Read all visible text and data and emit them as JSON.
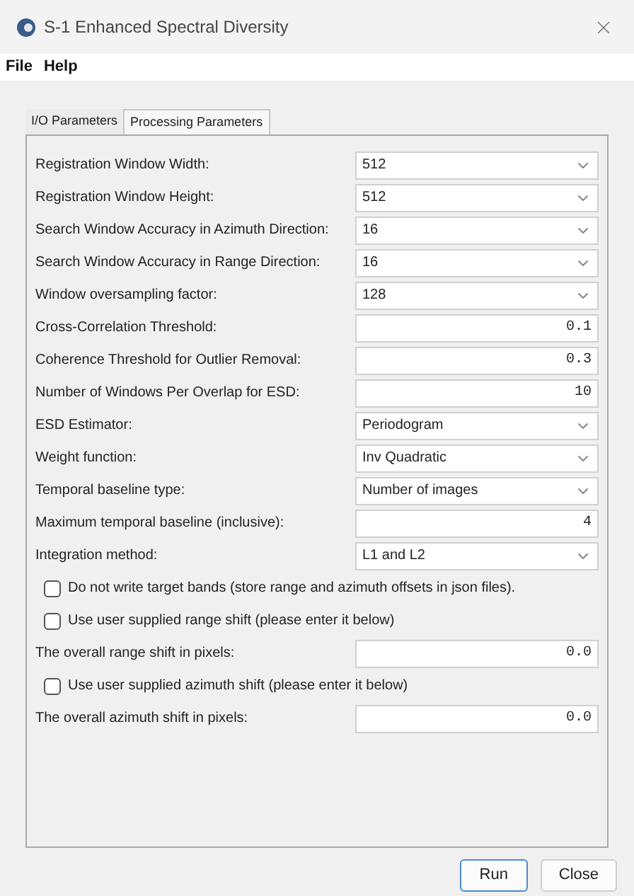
{
  "window": {
    "title": "S-1 Enhanced Spectral Diversity"
  },
  "menu": [
    "File",
    "Help"
  ],
  "tabs": [
    {
      "label": "I/O Parameters",
      "selected": false
    },
    {
      "label": "Processing Parameters",
      "selected": true
    }
  ],
  "rows": [
    {
      "kind": "combo",
      "label": "Registration Window Width:",
      "value": "512"
    },
    {
      "kind": "combo",
      "label": "Registration Window Height:",
      "value": "512"
    },
    {
      "kind": "combo",
      "label": "Search Window Accuracy in Azimuth Direction:",
      "value": "16"
    },
    {
      "kind": "combo",
      "label": "Search Window Accuracy in Range Direction:",
      "value": "16"
    },
    {
      "kind": "combo",
      "label": "Window oversampling factor:",
      "value": "128"
    },
    {
      "kind": "text",
      "label": "Cross-Correlation Threshold:",
      "value": "0.1"
    },
    {
      "kind": "text",
      "label": "Coherence Threshold for Outlier Removal:",
      "value": "0.3"
    },
    {
      "kind": "text",
      "label": "Number of Windows Per Overlap for ESD:",
      "value": "10"
    },
    {
      "kind": "combo",
      "label": "ESD Estimator:",
      "value": "Periodogram"
    },
    {
      "kind": "combo",
      "label": "Weight function:",
      "value": "Inv Quadratic"
    },
    {
      "kind": "combo",
      "label": "Temporal baseline type:",
      "value": "Number of images"
    },
    {
      "kind": "text",
      "label": "Maximum temporal baseline (inclusive):",
      "value": "4"
    },
    {
      "kind": "combo",
      "label": "Integration method:",
      "value": "L1 and L2"
    },
    {
      "kind": "checkbox",
      "label": "Do not write target bands (store range and azimuth offsets in json files).",
      "checked": false
    },
    {
      "kind": "checkbox",
      "label": "Use user supplied range shift (please enter it below)",
      "checked": false
    },
    {
      "kind": "text",
      "label": "The overall range shift in pixels:",
      "value": "0.0"
    },
    {
      "kind": "checkbox",
      "label": "Use user supplied azimuth shift (please enter it below)",
      "checked": false
    },
    {
      "kind": "text",
      "label": "The overall azimuth shift in pixels:",
      "value": "0.0"
    }
  ],
  "buttons": [
    {
      "label": "Run",
      "default": true
    },
    {
      "label": "Close",
      "default": false
    }
  ]
}
